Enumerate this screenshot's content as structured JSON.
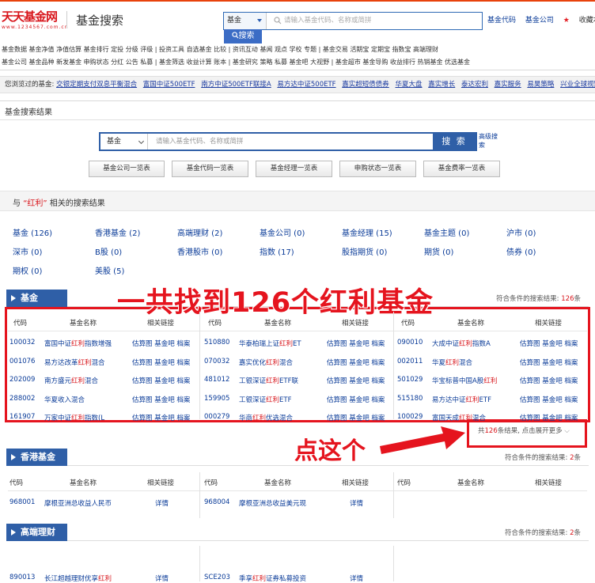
{
  "header": {
    "logo_cn": "天天基金网",
    "logo_en": "www.1234567.com.cn",
    "title": "基金搜索",
    "search_type": "基金",
    "search_placeholder": "请输入基金代码、名称或简拼",
    "search_button": "搜索",
    "links": [
      "基金代码",
      "基金公司",
      "收藏本站"
    ]
  },
  "nav": {
    "row1": "基金数据 基金净值 净值估算 基金排行 定投 分级 评级 | 投资工具 自选基金 比较 | 资讯互动 基闻 观点 学校 专题 | 基金交易 活期宝 定期宝 指数宝 高端理财",
    "row2": "基金公司 基金品种 新发基金 申购状态 分红 公告 私募 | 基金筛选 收益计算 账本 | 基金研究 策略 私募 基金吧 大视野 | 基金超市 基金导购 收益排行 热销基金 优选基金"
  },
  "recent": {
    "label": "您浏览过的基金:",
    "items": [
      "交银定期支付双息平衡混合",
      "富国中证500ETF",
      "南方中证500ETF联接A",
      "易方达中证500ETF",
      "嘉实超短债债券",
      "华夏大盘",
      "嘉实增长",
      "泰达宏利",
      "嘉实服务",
      "易昊策略",
      "兴业全球视野"
    ]
  },
  "results": {
    "title": "基金搜索结果",
    "search_type": "基金",
    "search_placeholder": "请输入基金代码、名称或简拼",
    "search_button": "搜 索",
    "advanced": "高级搜索",
    "quick_buttons": [
      "基金公司一览表",
      "基金代码一览表",
      "基金经理一览表",
      "申购状态一览表",
      "基金费率一览表"
    ],
    "related_prefix": "与",
    "keyword": "“红利”",
    "related_suffix": "相关的搜索结果",
    "categories": [
      "基金 (126)",
      "香港基金 (2)",
      "高端理财 (2)",
      "基金公司 (0)",
      "基金经理 (15)",
      "基金主题 (0)",
      "沪市 (0)",
      "深市 (0)",
      "B股 (0)",
      "香港股市 (0)",
      "指数 (17)",
      "股指期货 (0)",
      "期货 (0)",
      "债券 (0)",
      "期权 (0)",
      "美股 (5)"
    ]
  },
  "fund_section": {
    "label": "基金",
    "count_prefix": "符合条件的搜索结果: ",
    "count": "126",
    "count_suffix": "条",
    "headers": [
      "代码",
      "基金名称",
      "相关链接"
    ],
    "link_text": "估算图 基金吧 档案",
    "columns": [
      [
        {
          "code": "100032",
          "pre": "富国中证",
          "hl": "红利",
          "post": "指数增强"
        },
        {
          "code": "001076",
          "pre": "易方达改革",
          "hl": "红利",
          "post": "混合"
        },
        {
          "code": "202009",
          "pre": "南方盛元",
          "hl": "红利",
          "post": "混合"
        },
        {
          "code": "288002",
          "pre": "华夏收入混合",
          "hl": "",
          "post": ""
        },
        {
          "code": "161907",
          "pre": "万家中证",
          "hl": "红利",
          "post": "指数(L"
        }
      ],
      [
        {
          "code": "510880",
          "pre": "华泰柏瑞上证",
          "hl": "红利",
          "post": "ET"
        },
        {
          "code": "070032",
          "pre": "嘉实优化",
          "hl": "红利",
          "post": "混合"
        },
        {
          "code": "481012",
          "pre": "工银深证",
          "hl": "红利",
          "post": "ETF联"
        },
        {
          "code": "159905",
          "pre": "工银深证",
          "hl": "红利",
          "post": "ETF"
        },
        {
          "code": "000279",
          "pre": "华商",
          "hl": "红利",
          "post": "优选混合"
        }
      ],
      [
        {
          "code": "090010",
          "pre": "大成中证",
          "hl": "红利",
          "post": "指数A"
        },
        {
          "code": "002011",
          "pre": "华夏",
          "hl": "红利",
          "post": "混合"
        },
        {
          "code": "501029",
          "pre": "华宝标普中国A股",
          "hl": "红利",
          "post": ""
        },
        {
          "code": "515180",
          "pre": "易方达中证",
          "hl": "红利",
          "post": "ETF"
        },
        {
          "code": "100029",
          "pre": "富国天成",
          "hl": "红利",
          "post": "混合"
        }
      ]
    ],
    "more_prefix": "共",
    "more_count": "126",
    "more_suffix": "条结果, 点击展开更多"
  },
  "hk_section": {
    "label": "香港基金",
    "count_prefix": "符合条件的搜索结果: ",
    "count": "2",
    "count_suffix": "条",
    "headers": [
      "代码",
      "基金名称",
      "相关链接"
    ],
    "rows": [
      {
        "code": "968001",
        "name": "摩根亚洲总收益人民币",
        "link": "详情"
      },
      {
        "code": "968004",
        "name": "摩根亚洲总收益美元现",
        "link": "详情"
      }
    ]
  },
  "hep_section": {
    "label": "高端理财",
    "count_prefix": "符合条件的搜索结果: ",
    "count": "2",
    "count_suffix": "条",
    "rows": [
      {
        "code": "890013",
        "pre": "长江超越理财优享",
        "hl": "红利",
        "post": "",
        "link": "详情"
      },
      {
        "code": "SCE203",
        "pre": "季享",
        "hl": "红利",
        "post": "证券私募投资",
        "link": "详情"
      }
    ]
  },
  "annotations": {
    "found": "一共找到126个红利基金",
    "click": "点这个"
  },
  "colors": {
    "brand_red": "#d8161c",
    "blue": "#2f5fa7",
    "annotation": "#e5141e"
  }
}
